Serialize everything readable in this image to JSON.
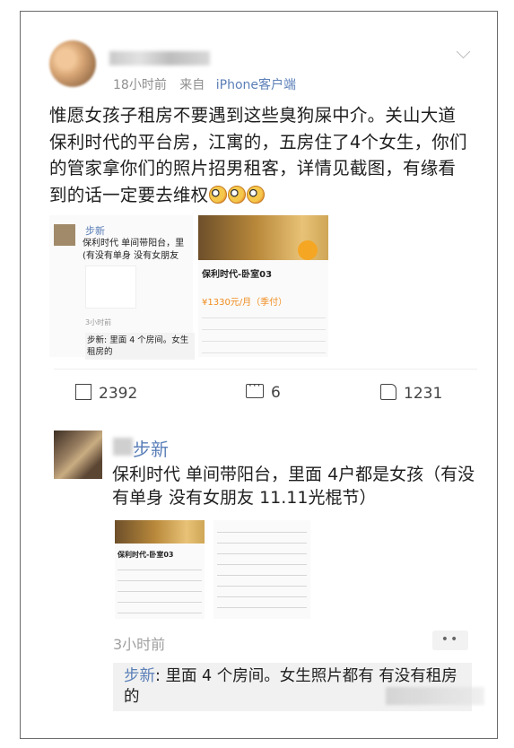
{
  "post": {
    "time": "18小时前",
    "source_prefix": "来自",
    "source_client": "iPhone客户端",
    "text": "惟愿女孩子租房不要遇到这些臭狗屎中介。关山大道保利时代的平台房，江寓的，五房住了4个女生，你们的管家拿你们的照片招男租客，详情见截图，有缘看到的话一定要去维权"
  },
  "thumb1": {
    "name": "步新",
    "text": "保利时代 单间带阳台，里(有没有单身 没有女朋友",
    "time": "3小时前",
    "reply": "步新: 里面 4 个房间。女生租房的"
  },
  "thumb2": {
    "title": "保利时代-卧室03",
    "price": "¥1330元/月（季付）"
  },
  "actions": {
    "share": "2392",
    "comment": "6",
    "like": "1231"
  },
  "comment": {
    "name": "步新",
    "text": "保利时代 单间带阳台，里面 4户都是女孩（有没有单身 没有女朋友 11.11光棍节）",
    "img_title": "保利时代-卧室03",
    "time": "3小时前",
    "more": "••",
    "reply_name": "步新",
    "reply_text": ": 里面 4 个房间。女生照片都有 有没有租房的"
  }
}
